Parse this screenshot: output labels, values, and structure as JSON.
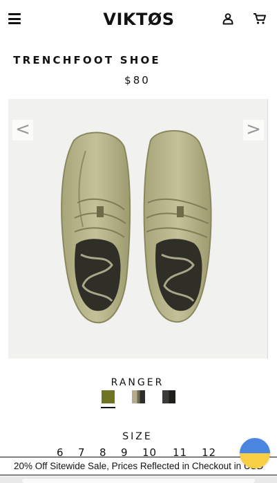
{
  "header": {
    "logo": "VIKTØS",
    "icons": [
      "menu-icon",
      "account-icon",
      "cart-icon"
    ]
  },
  "product": {
    "title": "TRENCHFOOT SHOE",
    "price": "$80"
  },
  "gallery": {
    "prev_label": "<",
    "next_label": ">"
  },
  "color": {
    "label": "RANGER",
    "swatches": [
      "#6f7421",
      "#b4ac8c",
      "#3a3b38"
    ]
  },
  "size": {
    "label": "SIZE",
    "options": [
      "6",
      "7",
      "8",
      "9",
      "10",
      "11",
      "12"
    ]
  },
  "promo": {
    "text": "20% Off Sitewide Sale, Prices Reflected in Checkout in USD"
  },
  "colors": {
    "flag_top": "#4a86e0",
    "flag_bottom": "#f6cf45"
  }
}
